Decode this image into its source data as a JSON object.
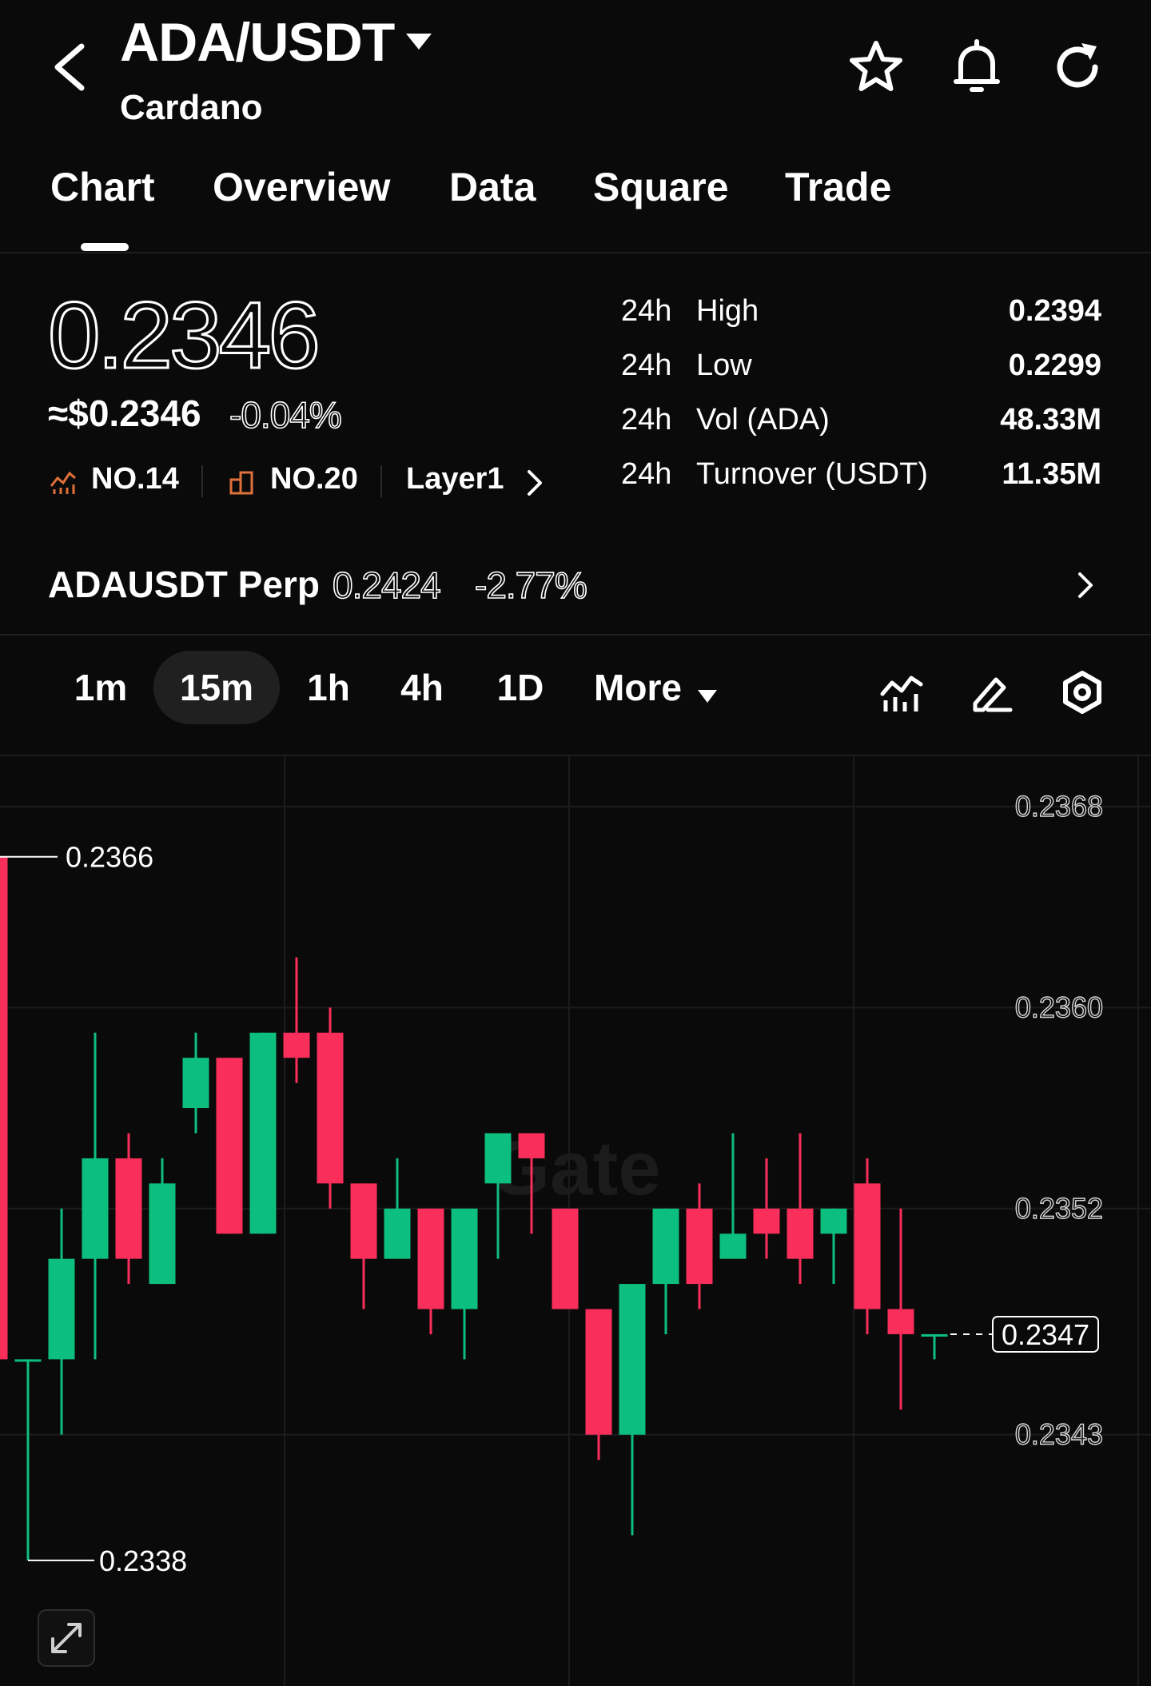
{
  "header": {
    "pair": "ADA/USDT",
    "name": "Cardano",
    "icons": [
      "back-arrow-icon",
      "caret-down-icon",
      "star-icon",
      "bell-icon",
      "refresh-icon"
    ]
  },
  "tabs": [
    {
      "label": "Chart",
      "active": true
    },
    {
      "label": "Overview"
    },
    {
      "label": "Data"
    },
    {
      "label": "Square"
    },
    {
      "label": "Trade"
    }
  ],
  "price": {
    "last": "0.2346",
    "approx_usd": "≈$0.2346",
    "change_pct": "-0.04%",
    "rank_market_cap": "NO.14",
    "rank_volume": "NO.20",
    "sector": "Layer1"
  },
  "stats": [
    {
      "period": "24h",
      "name": "High",
      "value": "0.2394"
    },
    {
      "period": "24h",
      "name": "Low",
      "value": "0.2299"
    },
    {
      "period": "24h",
      "name": "Vol (ADA)",
      "value": "48.33M"
    },
    {
      "period": "24h",
      "name": "Turnover (USDT)",
      "value": "11.35M"
    }
  ],
  "perp": {
    "name": "ADAUSDT Perp",
    "price": "0.2424",
    "change": "-2.77%"
  },
  "timeframes": {
    "items": [
      "1m",
      "15m",
      "1h",
      "4h",
      "1D"
    ],
    "active": "15m",
    "more_label": "More"
  },
  "colors": {
    "up": "#0dbf7e",
    "down": "#fa2e5a",
    "background": "#0a0a0a",
    "active_pill": "#202020"
  },
  "chart_data": {
    "type": "candlestick",
    "interval": "15m",
    "ylim": [
      0.2333,
      0.237
    ],
    "y_ticks": [
      "0.2368",
      "0.2360",
      "0.2352",
      "0.2343"
    ],
    "marked_high": "0.2366",
    "marked_low": "0.2338",
    "current_price": "0.2347",
    "watermark": "Gate",
    "candles": [
      {
        "o": 0.2366,
        "h": 0.2366,
        "l": 0.2341,
        "c": 0.2346
      },
      {
        "o": 0.2346,
        "h": 0.2346,
        "l": 0.2338,
        "c": 0.2346
      },
      {
        "o": 0.2346,
        "h": 0.2352,
        "l": 0.2343,
        "c": 0.235
      },
      {
        "o": 0.235,
        "h": 0.2359,
        "l": 0.2346,
        "c": 0.2354
      },
      {
        "o": 0.2354,
        "h": 0.2355,
        "l": 0.2349,
        "c": 0.235
      },
      {
        "o": 0.2349,
        "h": 0.2354,
        "l": 0.2349,
        "c": 0.2353
      },
      {
        "o": 0.2356,
        "h": 0.2359,
        "l": 0.2355,
        "c": 0.2358
      },
      {
        "o": 0.2358,
        "h": 0.2358,
        "l": 0.2351,
        "c": 0.2351
      },
      {
        "o": 0.2351,
        "h": 0.2359,
        "l": 0.2351,
        "c": 0.2359
      },
      {
        "o": 0.2359,
        "h": 0.2362,
        "l": 0.2357,
        "c": 0.2358
      },
      {
        "o": 0.2359,
        "h": 0.236,
        "l": 0.2352,
        "c": 0.2353
      },
      {
        "o": 0.2353,
        "h": 0.2353,
        "l": 0.2348,
        "c": 0.235
      },
      {
        "o": 0.235,
        "h": 0.2354,
        "l": 0.235,
        "c": 0.2352
      },
      {
        "o": 0.2352,
        "h": 0.2352,
        "l": 0.2347,
        "c": 0.2348
      },
      {
        "o": 0.2348,
        "h": 0.2352,
        "l": 0.2346,
        "c": 0.2352
      },
      {
        "o": 0.2353,
        "h": 0.2355,
        "l": 0.235,
        "c": 0.2355
      },
      {
        "o": 0.2355,
        "h": 0.2355,
        "l": 0.2351,
        "c": 0.2354
      },
      {
        "o": 0.2352,
        "h": 0.2352,
        "l": 0.2348,
        "c": 0.2348
      },
      {
        "o": 0.2348,
        "h": 0.2348,
        "l": 0.2342,
        "c": 0.2343
      },
      {
        "o": 0.2343,
        "h": 0.2349,
        "l": 0.2339,
        "c": 0.2349
      },
      {
        "o": 0.2349,
        "h": 0.2352,
        "l": 0.2347,
        "c": 0.2352
      },
      {
        "o": 0.2352,
        "h": 0.2353,
        "l": 0.2348,
        "c": 0.2349
      },
      {
        "o": 0.235,
        "h": 0.2355,
        "l": 0.235,
        "c": 0.2351
      },
      {
        "o": 0.2352,
        "h": 0.2354,
        "l": 0.235,
        "c": 0.2351
      },
      {
        "o": 0.2352,
        "h": 0.2355,
        "l": 0.2349,
        "c": 0.235
      },
      {
        "o": 0.2351,
        "h": 0.2352,
        "l": 0.2349,
        "c": 0.2352
      },
      {
        "o": 0.2353,
        "h": 0.2354,
        "l": 0.2347,
        "c": 0.2348
      },
      {
        "o": 0.2348,
        "h": 0.2352,
        "l": 0.2344,
        "c": 0.2347
      },
      {
        "o": 0.2347,
        "h": 0.2347,
        "l": 0.2346,
        "c": 0.2347
      }
    ]
  }
}
